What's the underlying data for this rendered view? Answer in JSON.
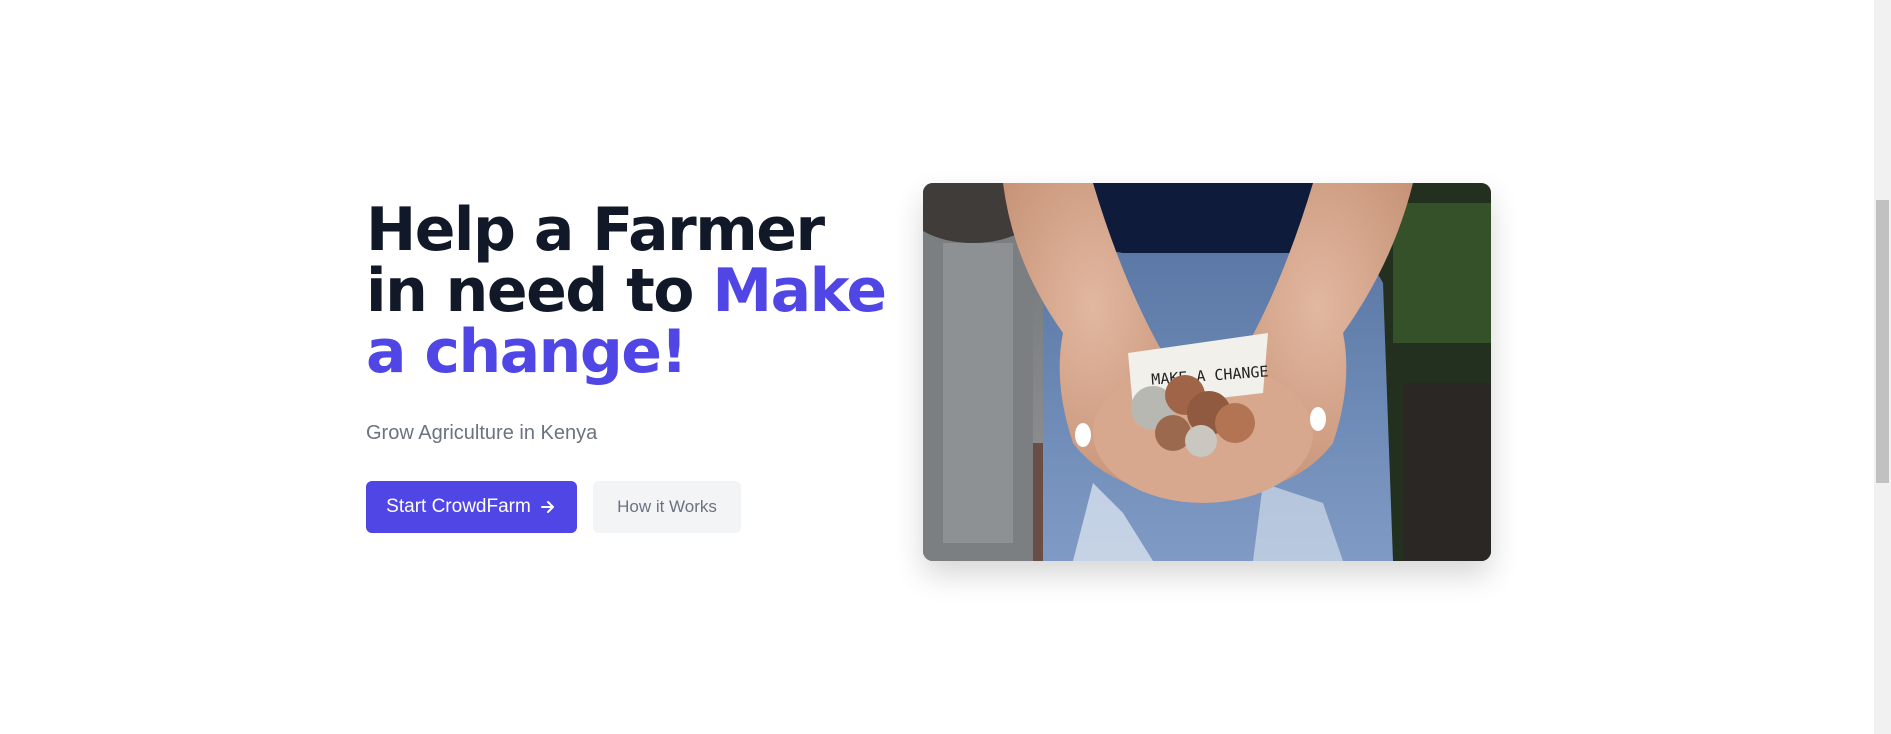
{
  "hero": {
    "headline_part1": "Help a Farmer in need to ",
    "headline_accent": "Make a change!",
    "subtitle": "Grow Agriculture in Kenya",
    "primary_button": {
      "label": "Start CrowdFarm",
      "icon": "arrow-right-icon"
    },
    "secondary_button": {
      "label": "How it Works"
    },
    "image": {
      "note_text": "MAKE A CHANGE"
    }
  },
  "colors": {
    "accent": "#4f46e5",
    "heading": "#111827",
    "muted": "#6b7280",
    "secondary_bg": "#f3f4f6"
  }
}
